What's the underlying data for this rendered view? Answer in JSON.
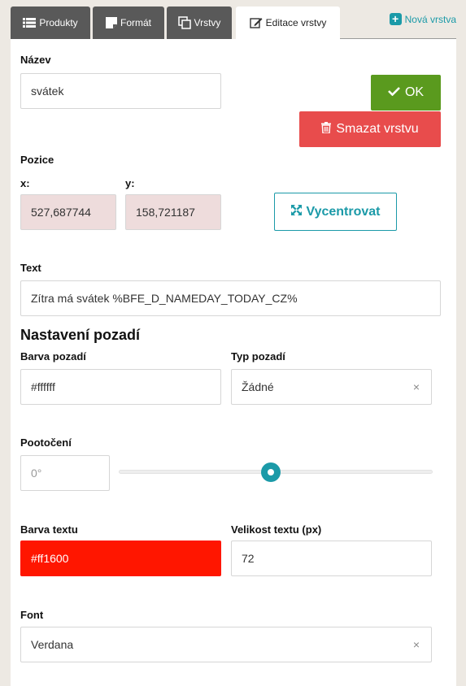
{
  "tabs": [
    {
      "label": "Produkty",
      "icon": "list-icon"
    },
    {
      "label": "Formát",
      "icon": "note-icon"
    },
    {
      "label": "Vrstvy",
      "icon": "copy-icon"
    },
    {
      "label": "Editace vrstvy",
      "icon": "edit-icon",
      "active": true
    }
  ],
  "add_layer_label": "Nová vrstva",
  "form": {
    "name_label": "Název",
    "name_value": "svátek",
    "ok_label": "OK",
    "delete_label": "Smazat vrstvu",
    "position_label": "Pozice",
    "x_label": "x:",
    "y_label": "y:",
    "x_value": "527,687744",
    "y_value": "158,721187",
    "center_label": "Vycentrovat",
    "text_label": "Text",
    "text_value": "Zítra má svátek %BFE_D_NAMEDAY_TODAY_CZ%",
    "bg_section_title": "Nastavení pozadí",
    "bg_color_label": "Barva pozadí",
    "bg_color_value": "#ffffff",
    "bg_type_label": "Typ pozadí",
    "bg_type_value": "Žádné",
    "rotation_label": "Pootočení",
    "rotation_placeholder": "0°",
    "rotation_level": 0.5,
    "text_color_label": "Barva textu",
    "text_color_value": "#ff1600",
    "text_size_label": "Velikost textu (px)",
    "text_size_value": "72",
    "font_label": "Font",
    "font_value": "Verdana",
    "clear_glyph": "×"
  },
  "colors": {
    "accent": "#1b9aa8",
    "ok": "#5a9a1e",
    "danger": "#e84c4c",
    "text_color_swatch": "#ff1600"
  }
}
